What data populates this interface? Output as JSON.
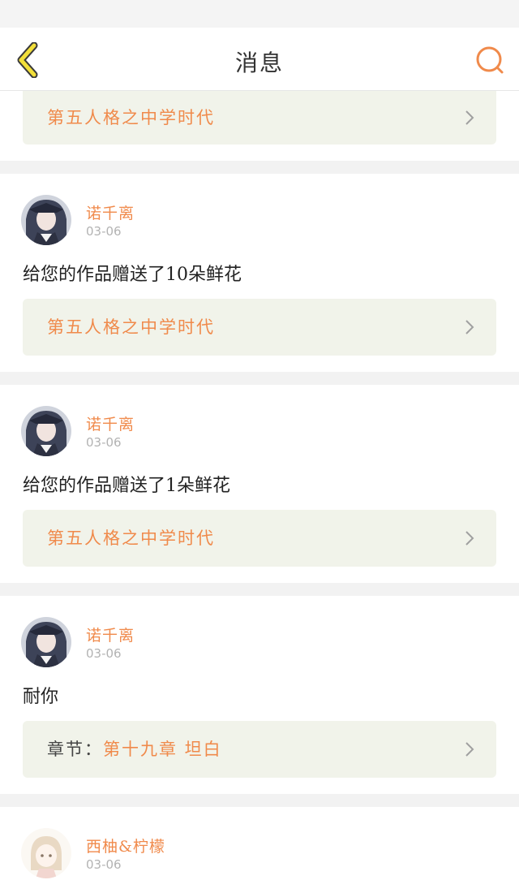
{
  "header": {
    "title": "消息",
    "back_icon": "chevron-left-icon",
    "search_icon": "search-icon",
    "accent": "#f2df3a",
    "search_color": "#f08a4b"
  },
  "colors": {
    "name": "#f08a4b",
    "link_bg": "#f1f3ea",
    "date": "#b3b3b3"
  },
  "messages": [
    {
      "link": "第五人格之中学时代"
    },
    {
      "user": "诺千离",
      "date": "03-06",
      "text": "给您的作品赠送了10朵鲜花",
      "link": "第五人格之中学时代"
    },
    {
      "user": "诺千离",
      "date": "03-06",
      "text": "给您的作品赠送了1朵鲜花",
      "link": "第五人格之中学时代"
    },
    {
      "user": "诺千离",
      "date": "03-06",
      "text": "耐你",
      "link_prefix": "章节：",
      "link": "第十九章 坦白"
    },
    {
      "user": "西柚&柠檬",
      "date": "03-06"
    }
  ]
}
